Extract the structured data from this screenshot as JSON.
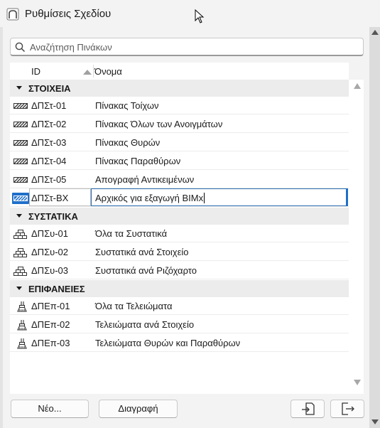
{
  "window": {
    "title": "Ρυθμίσεις Σχεδίου"
  },
  "search": {
    "placeholder": "Αναζήτηση Πινάκων",
    "value": ""
  },
  "columns": {
    "id": "ID",
    "name": "Όνομα"
  },
  "groups": [
    {
      "label": "ΣΤΟΙΧΕΙΑ",
      "icon": "hatch-icon",
      "rows": [
        {
          "id": "ΔΠΣτ-01",
          "name": "Πίνακας Τοίχων"
        },
        {
          "id": "ΔΠΣτ-02",
          "name": "Πίνακας Όλων των Ανοιγμάτων"
        },
        {
          "id": "ΔΠΣτ-03",
          "name": "Πίνακας Θυρών"
        },
        {
          "id": "ΔΠΣτ-04",
          "name": "Πίνακας Παραθύρων"
        },
        {
          "id": "ΔΠΣτ-05",
          "name": "Απογραφή Αντικειμένων"
        },
        {
          "id": "ΔΠΣτ-ΒΧ",
          "name": "Αρχικός για εξαγωγή BIMx",
          "selected": true,
          "editing": true
        }
      ]
    },
    {
      "label": "ΣΥΣΤΑΤΙΚΑ",
      "icon": "bricks-icon",
      "rows": [
        {
          "id": "ΔΠΣυ-01",
          "name": "Όλα τα Συστατικά"
        },
        {
          "id": "ΔΠΣυ-02",
          "name": "Συστατικά ανά Στοιχείο"
        },
        {
          "id": "ΔΠΣυ-03",
          "name": "Συστατικά ανά Ριζόχαρτο"
        }
      ]
    },
    {
      "label": "ΕΠΙΦΑΝΕΙΕΣ",
      "icon": "paint-brush-icon",
      "rows": [
        {
          "id": "ΔΠΕπ-01",
          "name": "Όλα τα Τελειώματα"
        },
        {
          "id": "ΔΠΕπ-02",
          "name": "Τελειώματα ανά Στοιχείο"
        },
        {
          "id": "ΔΠΕπ-03",
          "name": "Τελειώματα Θυρών και Παραθύρων"
        }
      ]
    }
  ],
  "buttons": {
    "new": "Νέο...",
    "delete": "Διαγραφή",
    "import_icon": "import-icon",
    "export_icon": "export-icon"
  },
  "colors": {
    "selection": "#1f6fc9",
    "group_bg": "#ececec"
  }
}
